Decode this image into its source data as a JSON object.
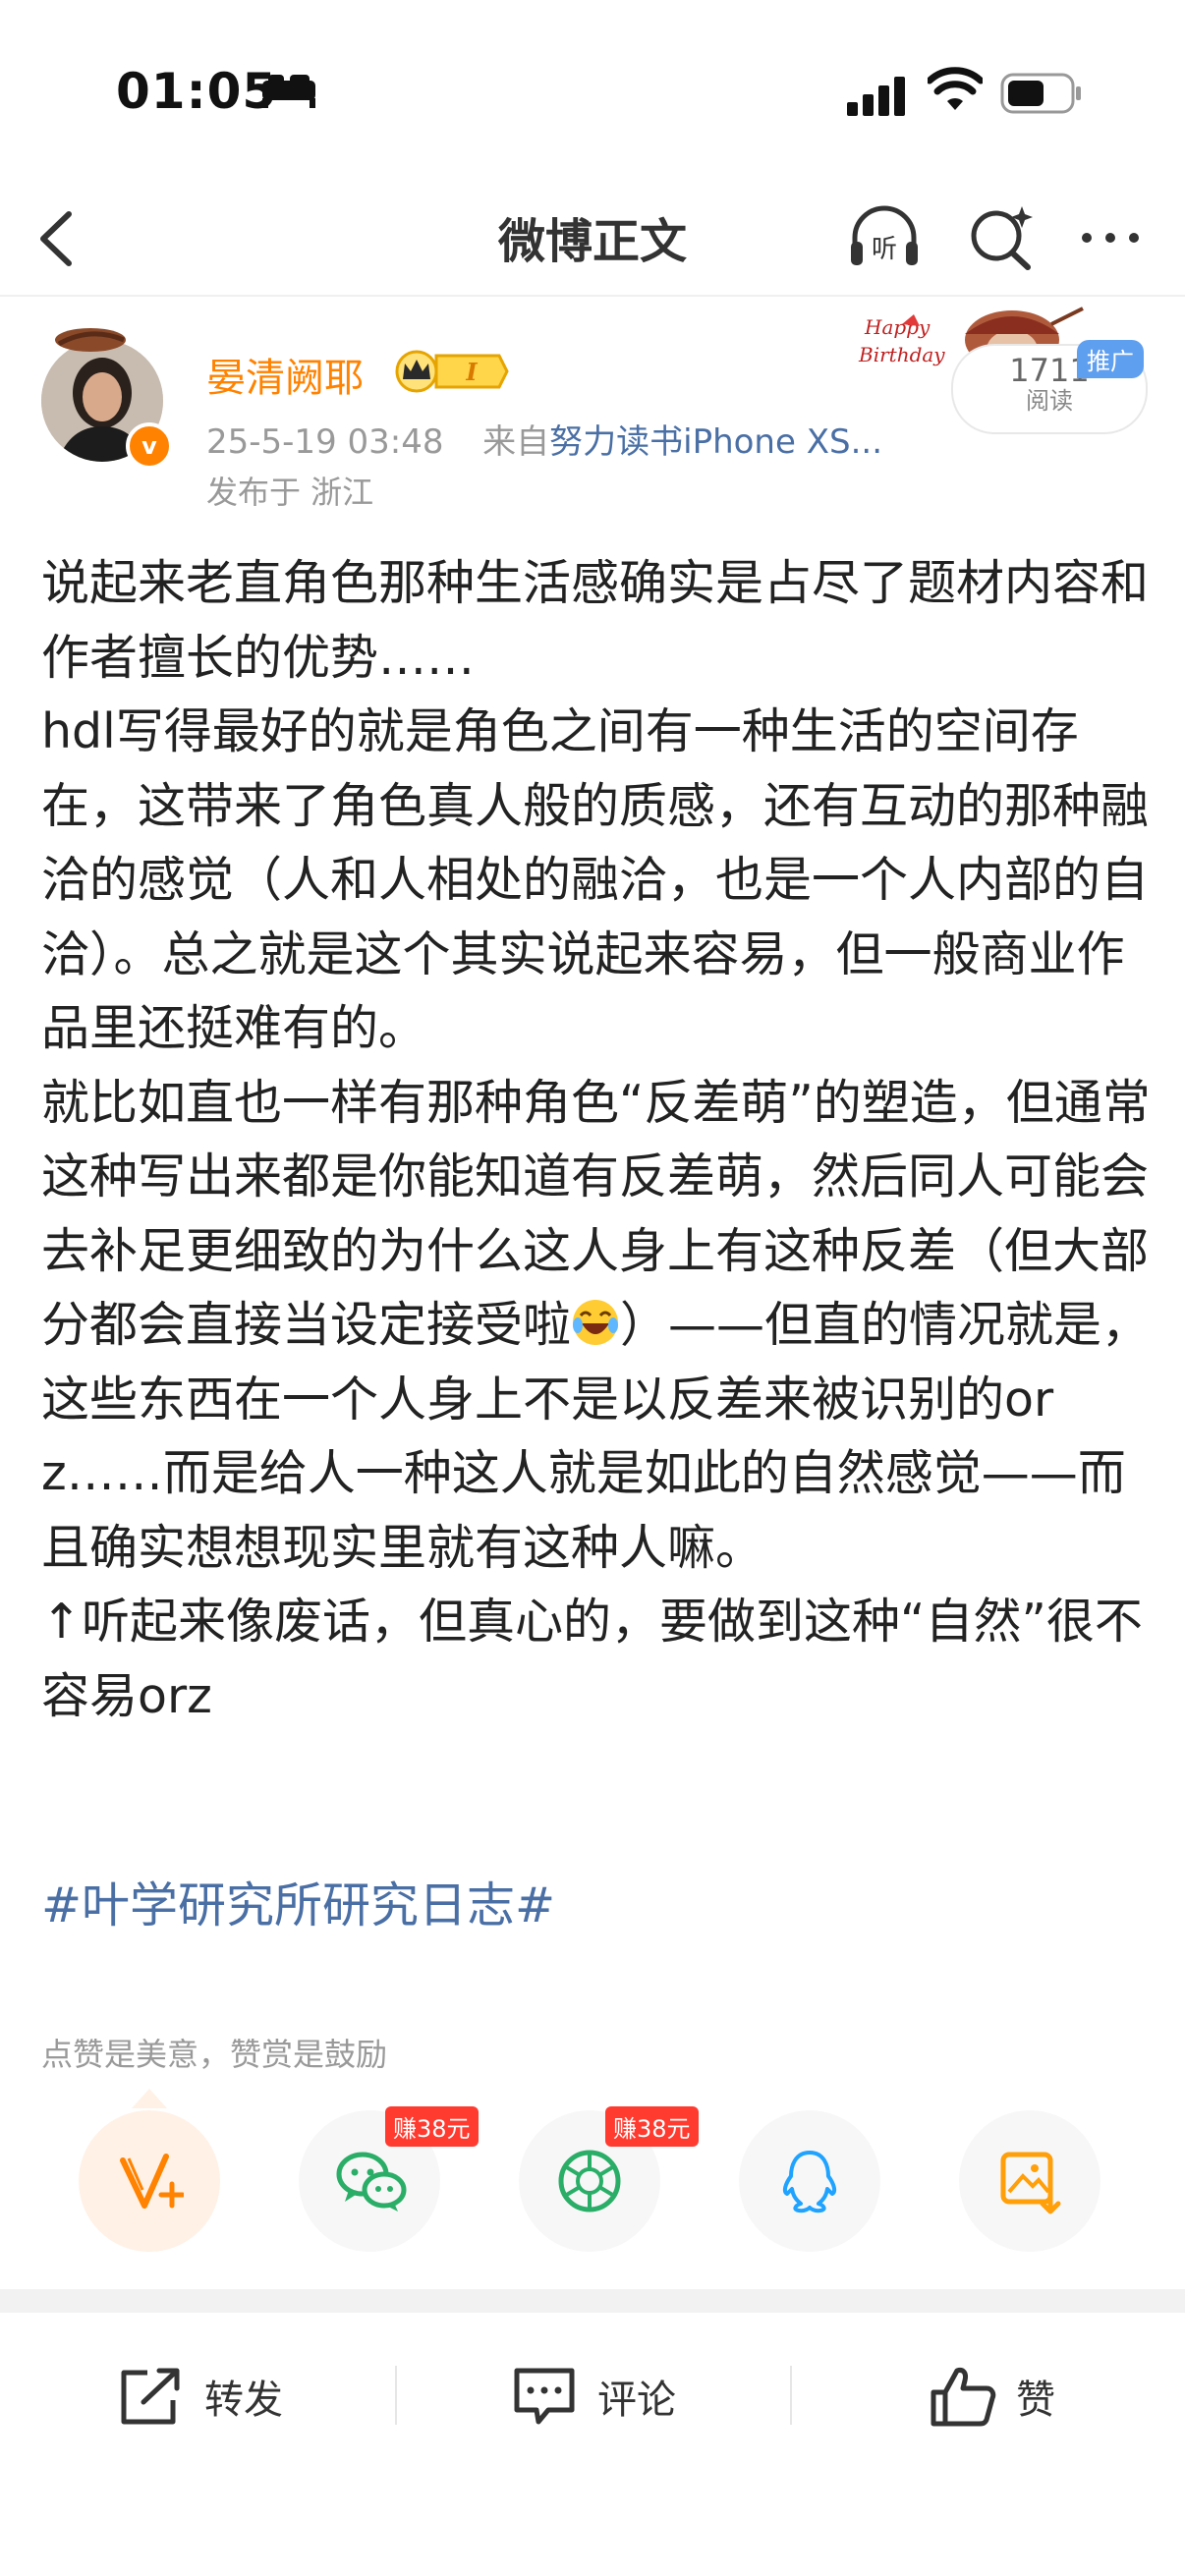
{
  "status_bar": {
    "time": "01:05"
  },
  "nav": {
    "title": "微博正文"
  },
  "author": {
    "name": "晏清阙耶",
    "verified_mark": "v",
    "level_badge": "I",
    "timestamp": "25-5-19 03:48",
    "source_prefix": "来自",
    "source": "努力读书iPhone XS...",
    "location": "发布于 浙江"
  },
  "promo": {
    "read_count": "1711",
    "read_label": "阅读",
    "ad_label": "推广"
  },
  "post": {
    "p1": "说起来老直角色那种生活感确实是占尽了题材内容和作者擅长的优势……",
    "p2": "hdl写得最好的就是角色之间有一种生活的空间存在，这带来了角色真人般的质感，还有互动的那种融洽的感觉（人和人相处的融洽，也是一个人内部的自洽）。总之就是这个其实说起来容易，但一般商业作品里还挺难有的。",
    "p3a": "就比如直也一样有那种角色“反差萌”的塑造，但通常这种写出来都是你能知道有反差萌，然后同人可能会去补足更细致的为什么这人身上有这种反差（但大部分都会直接当设定接受啦",
    "p3b": "）——但直的情况就是，这些东西在一个人身上不是以反差来被识别的orz……而是给人一种这人就是如此的自然感觉——而且确实想想现实里就有这种人嘛。",
    "p4": "↑听起来像废话，但真心的，要做到这种“自然”很不容易orz",
    "hashtag": "#叶学研究所研究日志#"
  },
  "reward": {
    "hint": "点赞是美意，赞赏是鼓励",
    "wechat_earn": "赚38元",
    "moments_earn": "赚38元"
  },
  "actions": {
    "repost": "转发",
    "comment": "评论",
    "like": "赞"
  },
  "colors": {
    "accent": "#ff8200",
    "link": "#4a6fa5",
    "earn": "#ff3b30",
    "wechat": "#2aae67"
  }
}
